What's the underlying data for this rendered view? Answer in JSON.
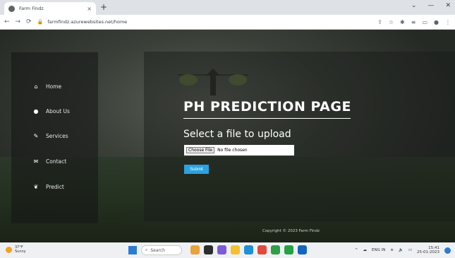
{
  "browser": {
    "tab_title": "Farm Findz",
    "tab_close": "×",
    "new_tab": "+",
    "url": "farmfindz.azurewebsites.net/home",
    "window_controls": [
      "⌄",
      "—",
      "✕"
    ]
  },
  "sidebar": {
    "items": [
      {
        "label": "Home",
        "icon": "home-icon",
        "glyph": "⌂"
      },
      {
        "label": "About Us",
        "icon": "user-icon",
        "glyph": "●"
      },
      {
        "label": "Services",
        "icon": "pencil-icon",
        "glyph": "✎"
      },
      {
        "label": "Contact",
        "icon": "envelope-icon",
        "glyph": "✉"
      },
      {
        "label": "Predict",
        "icon": "leaf-icon",
        "glyph": "❦"
      }
    ]
  },
  "main": {
    "heading": "PH PREDICTION PAGE",
    "subheading": "Select a file to upload",
    "choose_file": "Choose File",
    "no_file": "No file chosen",
    "submit": "Submit"
  },
  "footer": {
    "copyright": "Copyright © 2023 Farm Findz"
  },
  "taskbar": {
    "weather_temp": "37°F",
    "weather_desc": "Sunny",
    "search_placeholder": "Search",
    "tray_lang": "ENG IN",
    "time": "15:41",
    "date": "25-01-2023"
  }
}
